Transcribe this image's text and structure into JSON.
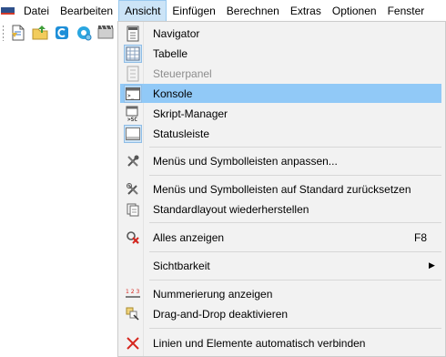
{
  "menubar": {
    "items": [
      {
        "label": "Datei"
      },
      {
        "label": "Bearbeiten"
      },
      {
        "label": "Ansicht"
      },
      {
        "label": "Einfügen"
      },
      {
        "label": "Berechnen"
      },
      {
        "label": "Extras"
      },
      {
        "label": "Optionen"
      },
      {
        "label": "Fenster"
      }
    ],
    "active": "Ansicht"
  },
  "toolbar": {
    "icons": [
      "new-document-icon",
      "open-folder-icon",
      "refresh-icon",
      "settings-gear-icon",
      "film-icon"
    ]
  },
  "menu": {
    "items": [
      {
        "label": "Navigator",
        "icon": "navigator-icon",
        "checked": true
      },
      {
        "label": "Tabelle",
        "icon": "table-icon",
        "checked": true
      },
      {
        "label": "Steuerpanel",
        "icon": "control-panel-icon",
        "disabled": true
      },
      {
        "label": "Konsole",
        "icon": "console-icon",
        "checked": true,
        "highlighted": true
      },
      {
        "label": "Skript-Manager",
        "icon": "script-manager-icon"
      },
      {
        "label": "Statusleiste",
        "icon": "statusbar-icon",
        "checked": true
      },
      {
        "label": "Menüs und Symbolleisten anpassen...",
        "icon": "customize-tools-icon"
      },
      {
        "label": "Menüs und Symbolleisten auf Standard zurücksetzen",
        "icon": "reset-tools-icon"
      },
      {
        "label": "Standardlayout wiederherstellen",
        "icon": "restore-layout-icon"
      },
      {
        "label": "Alles anzeigen",
        "icon": "show-all-icon",
        "shortcut": "F8"
      },
      {
        "label": "Sichtbarkeit",
        "icon": "",
        "submenu": true
      },
      {
        "label": "Nummerierung anzeigen",
        "icon": "numbering-icon"
      },
      {
        "label": "Drag-and-Drop deaktivieren",
        "icon": "drag-drop-icon"
      },
      {
        "label": "Linien und Elemente automatisch verbinden",
        "icon": "connect-lines-icon"
      }
    ]
  },
  "colors": {
    "highlight": "#91c9f7",
    "menu_bg": "#f2f2f2",
    "active_menu_bg": "#cce4f7"
  }
}
